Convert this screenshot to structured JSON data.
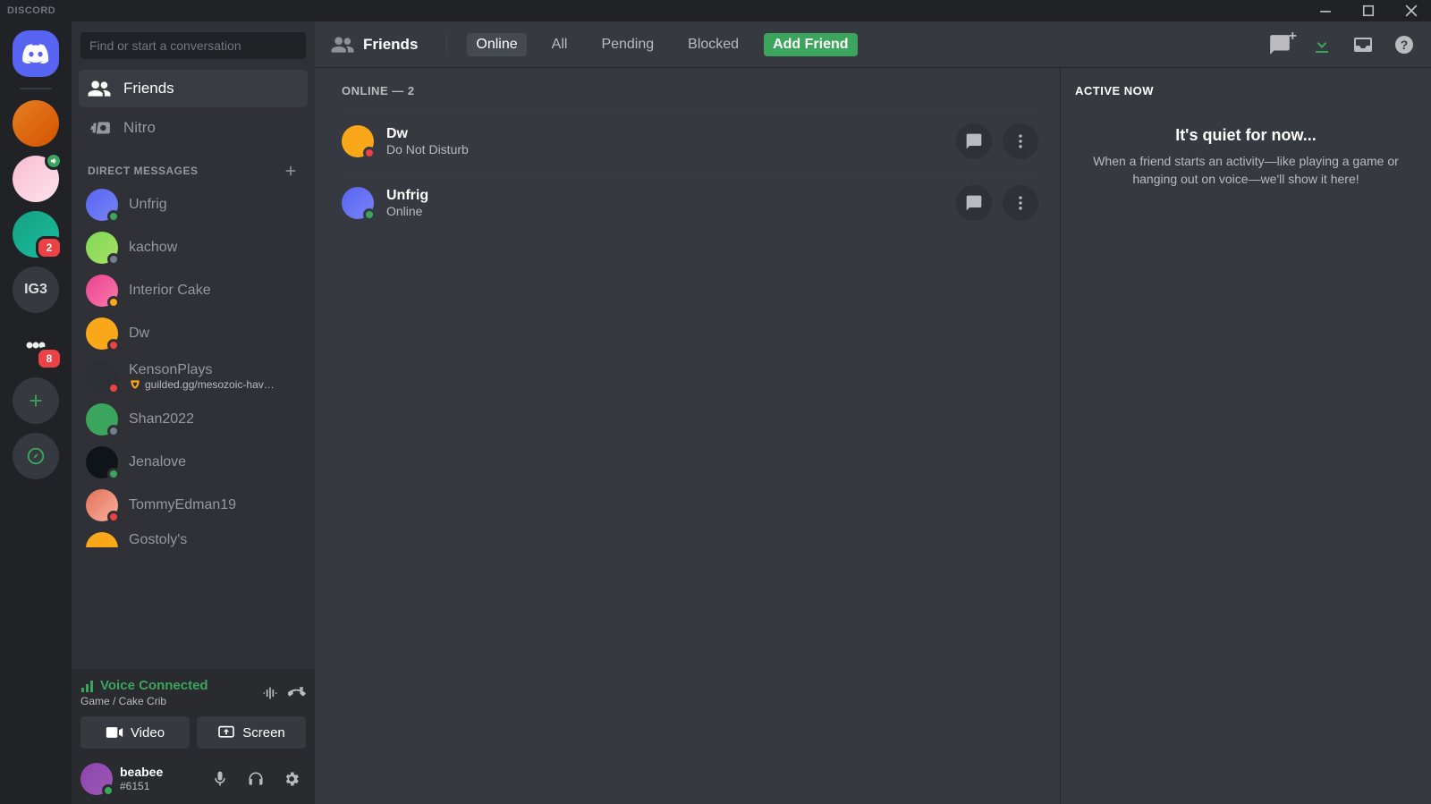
{
  "titlebar": {
    "app_name": "DISCORD"
  },
  "server_rail": {
    "servers": [
      {
        "name": "server-1",
        "badge": null,
        "voice": false
      },
      {
        "name": "server-2",
        "badge": null,
        "voice": true
      },
      {
        "name": "server-3",
        "badge": "2",
        "voice": false
      },
      {
        "name": "server-4-text",
        "label": "IG3",
        "badge": null,
        "voice": false
      },
      {
        "name": "server-5",
        "badge": "8",
        "voice": false
      }
    ]
  },
  "sidebar": {
    "search_placeholder": "Find or start a conversation",
    "friends_label": "Friends",
    "nitro_label": "Nitro",
    "dm_header": "DIRECT MESSAGES",
    "dms": [
      {
        "name": "Unfrig",
        "status": "online",
        "sub": null
      },
      {
        "name": "kachow",
        "status": "offline",
        "sub": null
      },
      {
        "name": "Interior Cake",
        "status": "idle",
        "sub": null
      },
      {
        "name": "Dw",
        "status": "dnd",
        "sub": null
      },
      {
        "name": "KensonPlays",
        "status": "dnd",
        "sub": "guilded.gg/mesozoic-hav…",
        "sub_icon": true
      },
      {
        "name": "Shan2022",
        "status": "offline",
        "sub": null
      },
      {
        "name": "Jenalove",
        "status": "online",
        "sub": null
      },
      {
        "name": "TommyEdman19",
        "status": "dnd",
        "sub": null
      },
      {
        "name": "Gostoly's",
        "status": "idle",
        "sub": null,
        "partial": true
      }
    ]
  },
  "voice": {
    "connected_label": "Voice Connected",
    "channel_label": "Game / Cake Crib",
    "video_label": "Video",
    "screen_label": "Screen"
  },
  "user": {
    "name": "beabee",
    "tag": "#6151"
  },
  "topbar": {
    "title": "Friends",
    "tabs": {
      "online": "Online",
      "all": "All",
      "pending": "Pending",
      "blocked": "Blocked",
      "add_friend": "Add Friend"
    }
  },
  "friends": {
    "list_header": "ONLINE — 2",
    "rows": [
      {
        "name": "Dw",
        "sub": "Do Not Disturb",
        "status": "dnd"
      },
      {
        "name": "Unfrig",
        "sub": "Online",
        "status": "online"
      }
    ]
  },
  "now_playing": {
    "header": "ACTIVE NOW",
    "title": "It's quiet for now...",
    "sub": "When a friend starts an activity—like playing a game or hanging out on voice—we'll show it here!"
  }
}
